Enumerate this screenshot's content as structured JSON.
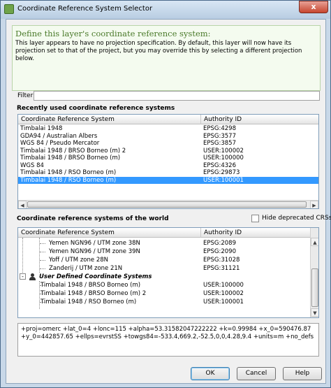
{
  "window": {
    "title": "Coordinate Reference System Selector",
    "close_label": "x"
  },
  "header": {
    "title": "Define this layer's coordinate reference system:",
    "description": "This layer appears to have no projection specification. By default, this layer will now have its projection set to that of the project, but you may override this by selecting a different projection below."
  },
  "filter": {
    "label": "Filter",
    "value": ""
  },
  "recent": {
    "label": "Recently used coordinate reference systems",
    "columns": [
      "Coordinate Reference System",
      "Authority ID"
    ],
    "rows": [
      {
        "name": "Timbalai 1948",
        "id": "EPSG:4298"
      },
      {
        "name": "GDA94 / Australian Albers",
        "id": "EPSG:3577"
      },
      {
        "name": "WGS 84 / Pseudo Mercator",
        "id": "EPSG:3857"
      },
      {
        "name": "Timbalai 1948 / BRSO Borneo (m) 2",
        "id": "USER:100002"
      },
      {
        "name": "Timbalai 1948 / BRSO Borneo (m)",
        "id": "USER:100000"
      },
      {
        "name": "WGS 84",
        "id": "EPSG:4326"
      },
      {
        "name": "Timbalai 1948 / RSO Borneo (m)",
        "id": "EPSG:29873"
      },
      {
        "name": "Timbalai 1948 / RSO Borneo (m)",
        "id": "USER:100001"
      }
    ],
    "selected_index": 7
  },
  "world": {
    "label": "Coordinate reference systems of the world",
    "hide_deprecated_label": "Hide deprecated CRSs",
    "hide_deprecated_checked": false,
    "columns": [
      "Coordinate Reference System",
      "Authority ID"
    ],
    "rows": [
      {
        "name": "Yemen NGN96 / UTM zone 38N",
        "id": "EPSG:2089"
      },
      {
        "name": "Yemen NGN96 / UTM zone 39N",
        "id": "EPSG:2090"
      },
      {
        "name": "Yoff / UTM zone 28N",
        "id": "EPSG:31028"
      },
      {
        "name": "Zanderij / UTM zone 21N",
        "id": "EPSG:31121"
      }
    ],
    "user_group": {
      "label": "User Defined Coordinate Systems",
      "toggle": "-",
      "rows": [
        {
          "name": "Timbalai 1948 / BRSO Borneo (m)",
          "id": "USER:100000"
        },
        {
          "name": "Timbalai 1948 / BRSO Borneo (m) 2",
          "id": "USER:100002"
        },
        {
          "name": "Timbalai 1948 / RSO Borneo (m)",
          "id": "USER:100001"
        }
      ]
    }
  },
  "proj_string": "+proj=omerc +lat_0=4 +lonc=115 +alpha=53.31582047222222 +k=0.99984 +x_0=590476.87 +y_0=442857.65 +ellps=evrstSS +towgs84=-533.4,669.2,-52.5,0,0,4.28,9.4 +units=m +no_defs",
  "buttons": {
    "ok": "OK",
    "cancel": "Cancel",
    "help": "Help"
  },
  "icons": {
    "app": "qgis-icon",
    "user_group": "user-icon",
    "scroll": [
      "arrow-left-icon",
      "arrow-right-icon",
      "arrow-up-icon",
      "arrow-down-icon"
    ]
  },
  "colors": {
    "selection": "#3399ff",
    "header_title": "#4a7a2a"
  }
}
